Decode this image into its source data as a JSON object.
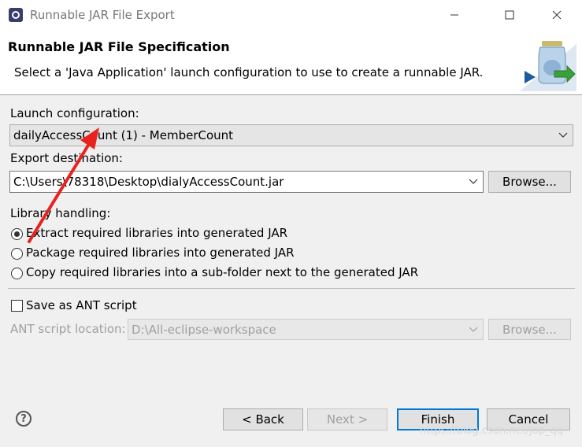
{
  "window": {
    "title": "Runnable JAR File Export",
    "minimize_icon": "minimize-icon",
    "maximize_icon": "maximize-icon",
    "close_icon": "close-icon"
  },
  "header": {
    "title": "Runnable JAR File Specification",
    "description": "Select a 'Java Application' launch configuration to use to create a runnable JAR."
  },
  "launch": {
    "label": "Launch configuration:",
    "value": "dailyAccessCount (1) - MemberCount"
  },
  "export": {
    "label": "Export destination:",
    "value": "C:\\Users\\78318\\Desktop\\dialyAccessCount.jar",
    "browse_label": "Browse..."
  },
  "library": {
    "label": "Library handling:",
    "options": [
      {
        "label": "Extract required libraries into generated JAR",
        "checked": true
      },
      {
        "label": "Package required libraries into generated JAR",
        "checked": false
      },
      {
        "label": "Copy required libraries into a sub-folder next to the generated JAR",
        "checked": false
      }
    ]
  },
  "ant": {
    "save_label": "Save as ANT script",
    "save_checked": false,
    "location_label": "ANT script location:",
    "location_value": "D:\\All-eclipse-workspace",
    "browse_label": "Browse..."
  },
  "footer": {
    "help_icon": "help-icon",
    "help_glyph": "?",
    "back_label": "< Back",
    "next_label": "Next >",
    "finish_label": "Finish",
    "cancel_label": "Cancel",
    "watermark": "https://blog.csdn.net/Jop_qq"
  },
  "colors": {
    "annotation_arrow": "#e8231f",
    "focus_border": "#0078d7",
    "dialog_bg": "#f0f0f0"
  }
}
